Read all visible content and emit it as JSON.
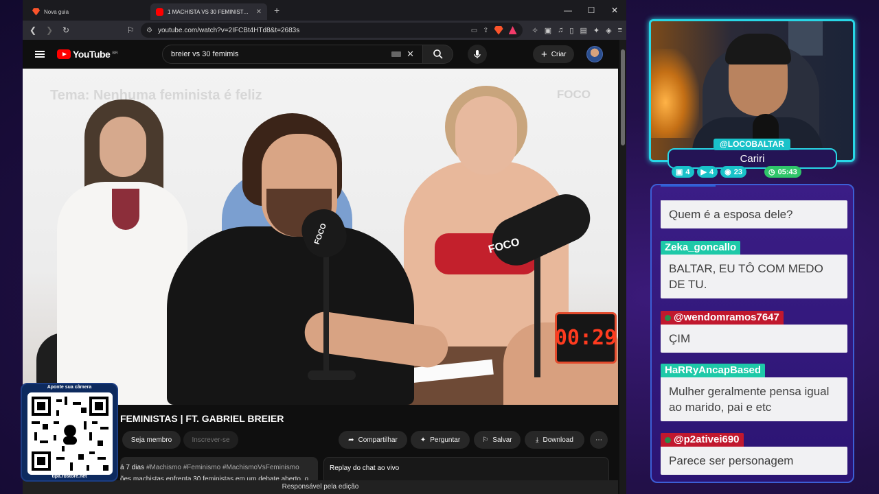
{
  "browser": {
    "tabs": [
      {
        "title": "Nova guia",
        "active": false
      },
      {
        "title": "1 MACHISTA VS 30 FEMINISTAS | FT. GABRIEL BREIER",
        "active": true
      }
    ],
    "url": "youtube.com/watch?v=2IFCBt4HTd8&t=2683s",
    "shield_badge": "99+",
    "rewards_badge": "1"
  },
  "youtube": {
    "logo_text": "YouTube",
    "country_code": "BR",
    "search_query": "breier vs 30 femimis",
    "create_label": "Criar",
    "video": {
      "watermark_title": "Tema: Nenhuma feminista é feliz",
      "watermark_logo": "FOCO",
      "mic_brand": "FOCO",
      "timer": "00:29"
    },
    "title": "FEMINISTAS | FT. GABRIEL BREIER",
    "buttons": {
      "member": "Seja membro",
      "subscribe": "Inscrever-se",
      "share": "Compartilhar",
      "ask": "Perguntar",
      "save": "Salvar",
      "download": "Download",
      "more": "⋯"
    },
    "description": {
      "date": "á 7 dias",
      "tags": "#Machismo #Feminismo #MachismoVsFeminismo",
      "snippet": "ões machistas enfrenta 30 feministas em um debate aberto, o"
    },
    "chat_replay_label": "Replay do chat ao vivo",
    "edit_bar": "Responsável pela edição"
  },
  "qr_card": {
    "top_text": "Aponte sua câmera",
    "bottom_text": "tipa.rbstore.net"
  },
  "stream": {
    "handle": "@LOCOBALTAR",
    "city": "Cariri",
    "stats": [
      {
        "icon": "twitch-icon",
        "value": "4",
        "color": "#19c2c9"
      },
      {
        "icon": "youtube-icon",
        "value": "4",
        "color": "#19c2c9"
      },
      {
        "icon": "kick-icon",
        "value": "23",
        "color": "#19c2c9"
      },
      {
        "icon": "clock-icon",
        "value": "05:43",
        "color": "#2fc56a"
      }
    ]
  },
  "chat": {
    "messages": [
      {
        "user": "",
        "text": "Quem é a esposa dele?",
        "color": "#2b63d6"
      },
      {
        "user": "Zeka_goncallo",
        "text": "BALTAR, EU TÔ COM MEDO DE TU.",
        "color": "#1ec9a8"
      },
      {
        "user": "@wendomramos7647",
        "text": "ÇIM",
        "color": "#c1182e"
      },
      {
        "user": "HaRRyAncapBased",
        "text": "Mulher geralmente pensa igual ao marido, pai e etc",
        "color": "#1ec9a8"
      },
      {
        "user": "@p2ativei690",
        "text": "Parece ser personagem",
        "color": "#c1182e"
      }
    ]
  }
}
